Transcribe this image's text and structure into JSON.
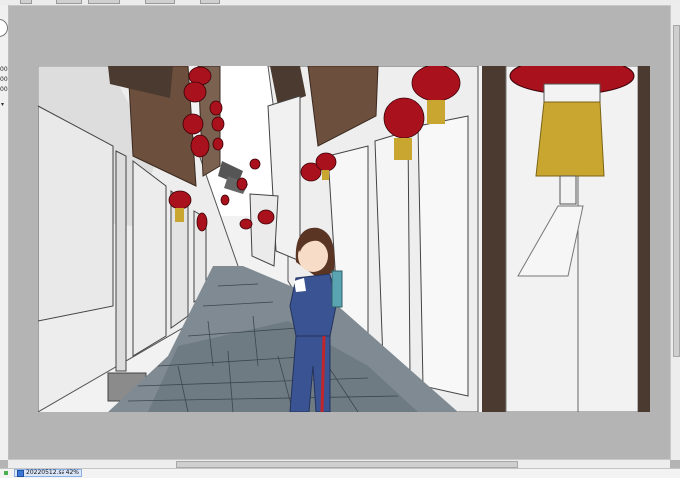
{
  "status_bar": {
    "file_name": "20220512.sai2",
    "zoom": "42%"
  },
  "left_panel": {
    "numbers": [
      "00",
      "00",
      "00"
    ]
  },
  "icons": {
    "file": "document-icon",
    "brush_ring": "brush-size-ring-icon",
    "chevron": "chevron-down-icon"
  },
  "colors": {
    "workspace_bg": "#b4b4b4",
    "lantern_red": "#a9111c",
    "tassel_gold": "#c9a630",
    "uniform_blue": "#3a5392",
    "pole_brown": "#4b3a2f"
  }
}
